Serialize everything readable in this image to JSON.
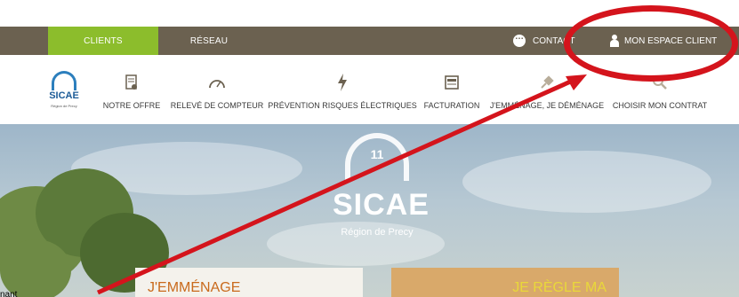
{
  "topbar": {
    "tabs": [
      "CLIENTS",
      "RÉSEAU"
    ],
    "contact_label": "CONTACT",
    "espace_label": "MON ESPACE CLIENT"
  },
  "logo": {
    "name": "SICAE",
    "subtitle": "Région de Precy"
  },
  "nav": {
    "items": [
      {
        "label": "NOTRE OFFRE",
        "icon": "document-icon"
      },
      {
        "label": "RELEVÉ DE COMPTEUR",
        "icon": "gauge-icon"
      },
      {
        "label": "PRÉVENTION RISQUES ÉLECTRIQUES",
        "icon": "lightning-icon"
      },
      {
        "label": "FACTURATION",
        "icon": "bill-icon"
      },
      {
        "label": "J'EMMÉNAGE, JE DÉMÉNAGE",
        "icon": "plug-icon"
      },
      {
        "label": "CHOISIR MON CONTRAT",
        "icon": "magnifier-icon"
      }
    ]
  },
  "hero": {
    "logo_name": "SICAE",
    "logo_subtitle": "Région de Precy",
    "logo_number": "11",
    "card_left": "J'EMMÉNAGE",
    "card_right": "JE RÈGLE MA"
  },
  "side_label": "nant",
  "colors": {
    "topbar": "#6b6150",
    "clients_tab": "#8cbd2c",
    "annotation": "#d4141c"
  }
}
